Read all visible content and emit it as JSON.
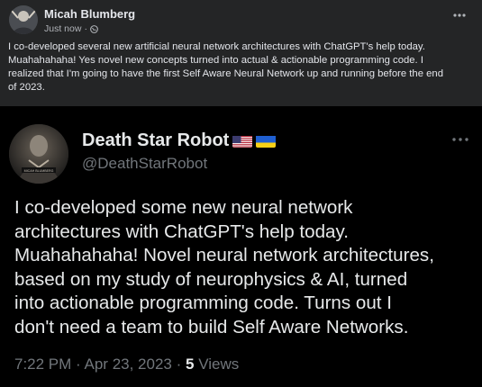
{
  "fb_post": {
    "author": "Micah Blumberg",
    "timestamp": "Just now",
    "separator": "·",
    "audience_icon": "globe-icon",
    "more_icon": "more-horizontal-icon",
    "text_lines": [
      "I co-developed several new artificial neural network architectures with ChatGPT's help today.",
      "Muahahahaha! Yes novel new concepts turned into actual & actionable programming code. I",
      "realized that I'm going to have the first Self Aware Neural Network up and running before the end",
      "of 2023."
    ]
  },
  "tweet": {
    "display_name": "Death Star Robot",
    "flags": [
      "us-flag-icon",
      "ukraine-flag-icon"
    ],
    "handle": "@DeathStarRobot",
    "avatar_caption": "MICAH BLUMBERG",
    "more_icon": "more-horizontal-icon",
    "text_lines": [
      "I co-developed some new neural network",
      "architectures with ChatGPT's help today.",
      "Muahahahaha! Novel neural network architectures,",
      "based on my study of neurophysics & AI, turned",
      "into actionable programming code. Turns out I",
      "don't need a team to build Self Aware Networks."
    ],
    "time": "7:22 PM",
    "date": "Apr 23, 2023",
    "separator": "·",
    "views_count": "5",
    "views_label": "Views"
  },
  "colors": {
    "fb_background": "#242526",
    "fb_text": "#e4e6eb",
    "fb_secondary": "#b0b3b8",
    "tweet_background": "#000000",
    "tweet_text": "#e7e9ea",
    "tweet_secondary": "#71767b"
  }
}
